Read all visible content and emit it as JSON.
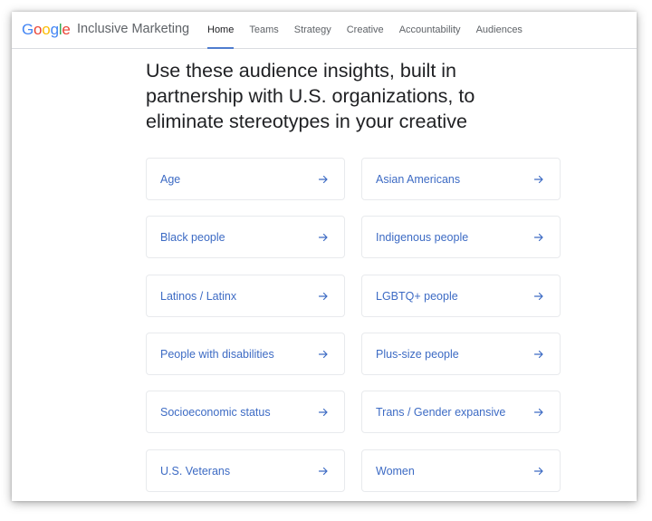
{
  "header": {
    "logo_letters": [
      {
        "char": "G",
        "color": "#4285f4"
      },
      {
        "char": "o",
        "color": "#ea4335"
      },
      {
        "char": "o",
        "color": "#fbbc05"
      },
      {
        "char": "g",
        "color": "#4285f4"
      },
      {
        "char": "l",
        "color": "#34a853"
      },
      {
        "char": "e",
        "color": "#ea4335"
      }
    ],
    "site_title": "Inclusive Marketing",
    "nav": [
      {
        "label": "Home",
        "active": true
      },
      {
        "label": "Teams",
        "active": false
      },
      {
        "label": "Strategy",
        "active": false
      },
      {
        "label": "Creative",
        "active": false
      },
      {
        "label": "Accountability",
        "active": false
      },
      {
        "label": "Audiences",
        "active": false
      }
    ]
  },
  "main": {
    "headline": "Use these audience insights, built in partnership with U.S. organizations, to eliminate stereotypes in your creative",
    "audience_cards": [
      {
        "label": "Age",
        "icon": "arrow-right-icon"
      },
      {
        "label": "Asian Americans",
        "icon": "arrow-right-icon"
      },
      {
        "label": "Black people",
        "icon": "arrow-right-icon"
      },
      {
        "label": "Indigenous people",
        "icon": "arrow-right-icon"
      },
      {
        "label": "Latinos / Latinx",
        "icon": "arrow-right-icon"
      },
      {
        "label": "LGBTQ+ people",
        "icon": "arrow-right-icon"
      },
      {
        "label": "People with disabilities",
        "icon": "arrow-right-icon"
      },
      {
        "label": "Plus-size people",
        "icon": "arrow-right-icon"
      },
      {
        "label": "Socioeconomic status",
        "icon": "arrow-right-icon"
      },
      {
        "label": "Trans / Gender expansive",
        "icon": "arrow-right-icon"
      },
      {
        "label": "U.S. Veterans",
        "icon": "arrow-right-icon"
      },
      {
        "label": "Women",
        "icon": "arrow-right-icon"
      }
    ]
  },
  "colors": {
    "accent": "#3d6bc4",
    "nav_underline": "#4f7ccf",
    "text_dark": "#202124",
    "text_muted": "#5f6368",
    "card_border": "#e8eaed"
  }
}
